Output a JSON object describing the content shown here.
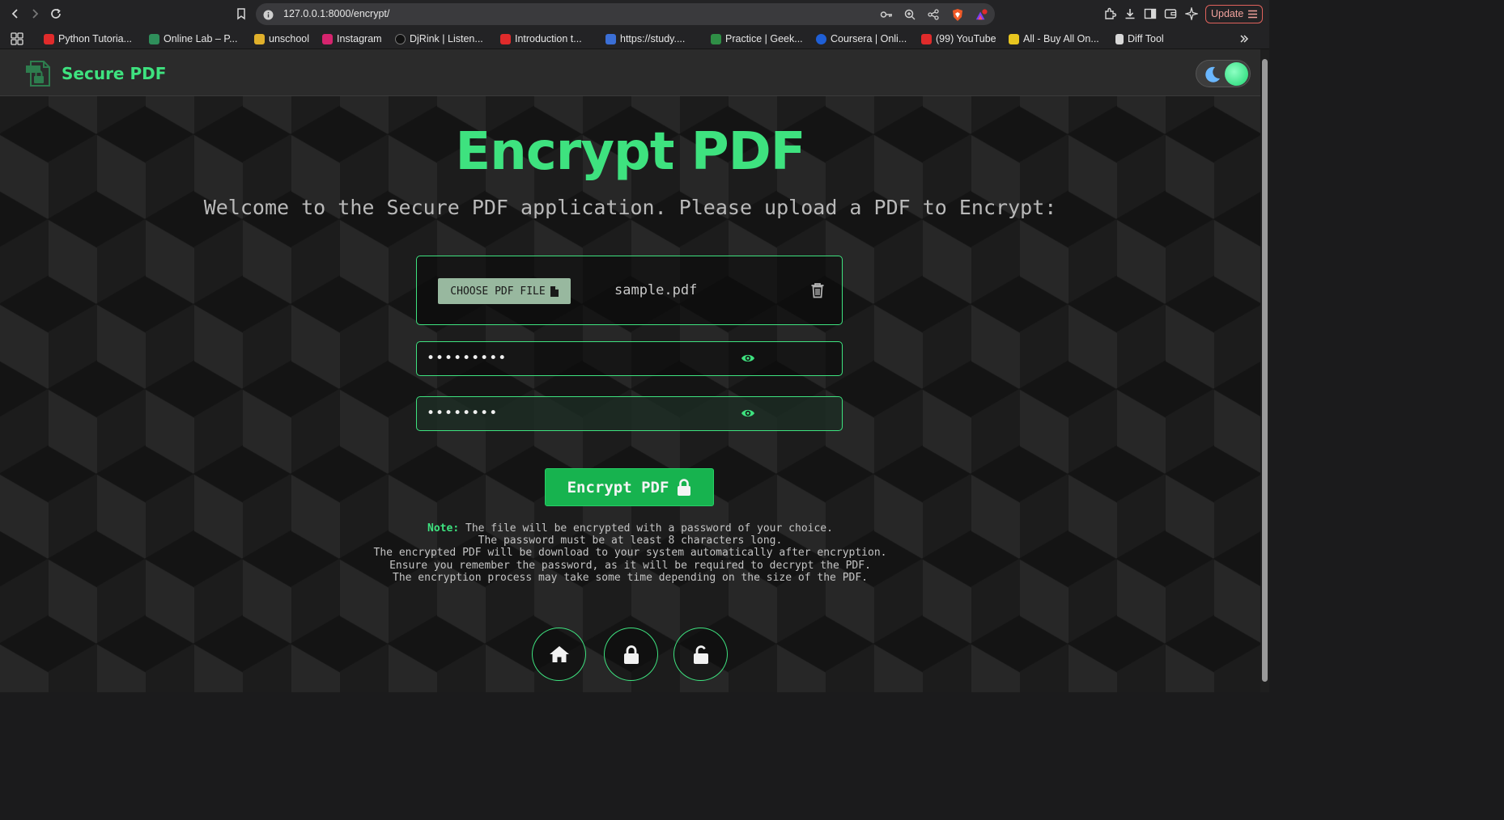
{
  "browser": {
    "url": "127.0.0.1:8000/encrypt/",
    "update_label": "Update",
    "bookmarks": [
      {
        "label": "Python Tutoria...",
        "color": "#e02b2b"
      },
      {
        "label": "Online Lab – P...",
        "color": "#2f8f5b"
      },
      {
        "label": "unschool",
        "color": "#e0b02b"
      },
      {
        "label": "Instagram",
        "color": "#d6246e"
      },
      {
        "label": "DjRink | Listen...",
        "color": "#111111"
      },
      {
        "label": "Introduction t...",
        "color": "#e02b2b"
      },
      {
        "label": "https://study....",
        "color": "#3b6fd6"
      },
      {
        "label": "Practice | Geek...",
        "color": "#2f8f46"
      },
      {
        "label": "Coursera | Onli...",
        "color": "#1f5fd6"
      },
      {
        "label": "(99) YouTube",
        "color": "#e02b2b"
      },
      {
        "label": "All - Buy All On...",
        "color": "#e8c61f"
      },
      {
        "label": "Diff Tool",
        "color": "#d8d8d8"
      }
    ]
  },
  "app": {
    "brand": "Secure PDF",
    "title": "Encrypt PDF",
    "subtitle": "Welcome to the Secure PDF application. Please upload a PDF to Encrypt:",
    "choose_label": "CHOOSE PDF FILE",
    "file_name": "sample.pdf",
    "password_mask": "•••••••••",
    "confirm_mask": "••••••••",
    "encrypt_label": "Encrypt PDF",
    "note_label": "Note:",
    "note_lines": [
      "The file will be encrypted with a password of your choice.",
      "The password must be at least 8 characters long.",
      "The encrypted PDF will be download to your system automatically after encryption.",
      "Ensure you remember the password, as it will be required to decrypt the PDF.",
      "The encryption process may take some time depending on the size of the PDF."
    ],
    "accent_color": "#3ee27f"
  }
}
